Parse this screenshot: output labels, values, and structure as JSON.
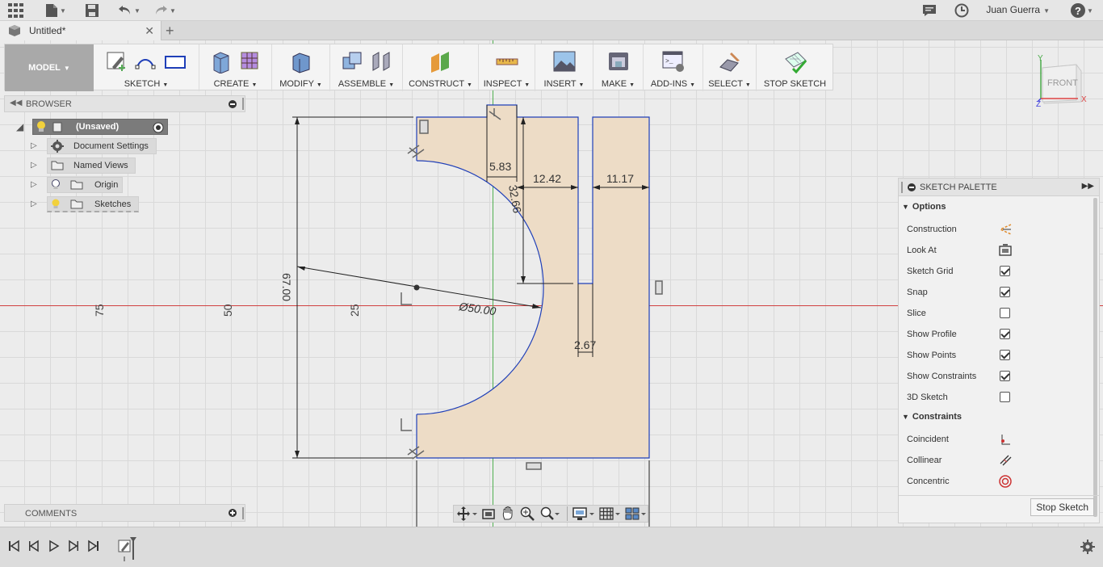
{
  "appbar": {
    "user_name": "Juan Guerra"
  },
  "tab": {
    "title": "Untitled*",
    "close": "✕",
    "new": "+"
  },
  "toolbar": {
    "model_label": "MODEL",
    "groups": [
      "SKETCH",
      "CREATE",
      "MODIFY",
      "ASSEMBLE",
      "CONSTRUCT",
      "INSPECT",
      "INSERT",
      "MAKE",
      "ADD-INS",
      "SELECT",
      "STOP SKETCH"
    ]
  },
  "viewcube": {
    "face": "FRONT",
    "axis_x": "X",
    "axis_y": "Y",
    "axis_z": "Z"
  },
  "browser": {
    "title": "BROWSER",
    "root": "(Unsaved)",
    "items": [
      "Document Settings",
      "Named Views",
      "Origin",
      "Sketches"
    ]
  },
  "comments": {
    "title": "COMMENTS"
  },
  "sketch": {
    "grid_labels": [
      "75",
      "50",
      "25"
    ],
    "dimensions": {
      "d1": "5.83",
      "d2": "12.42",
      "d3": "11.17",
      "d4": "32.66",
      "d5": "67.00",
      "d6": "Ø50.00",
      "d7": "2.67"
    }
  },
  "palette": {
    "title": "SKETCH PALETTE",
    "sections": {
      "options": "Options",
      "constraints": "Constraints"
    },
    "options": [
      {
        "label": "Construction",
        "type": "icon",
        "icon": "construction-icon"
      },
      {
        "label": "Look At",
        "type": "icon",
        "icon": "look-at-icon"
      },
      {
        "label": "Sketch Grid",
        "type": "check",
        "checked": true
      },
      {
        "label": "Snap",
        "type": "check",
        "checked": true
      },
      {
        "label": "Slice",
        "type": "check",
        "checked": false
      },
      {
        "label": "Show Profile",
        "type": "check",
        "checked": true
      },
      {
        "label": "Show Points",
        "type": "check",
        "checked": true
      },
      {
        "label": "Show Constraints",
        "type": "check",
        "checked": true
      },
      {
        "label": "3D Sketch",
        "type": "check",
        "checked": false
      }
    ],
    "constraints": [
      "Coincident",
      "Collinear",
      "Concentric"
    ],
    "stop_button": "Stop Sketch"
  },
  "colors": {
    "sketch_line": "#1f3fb8",
    "profile_fill": "#eddcc6",
    "axis_red": "#d04040",
    "axis_green": "#40b040"
  }
}
